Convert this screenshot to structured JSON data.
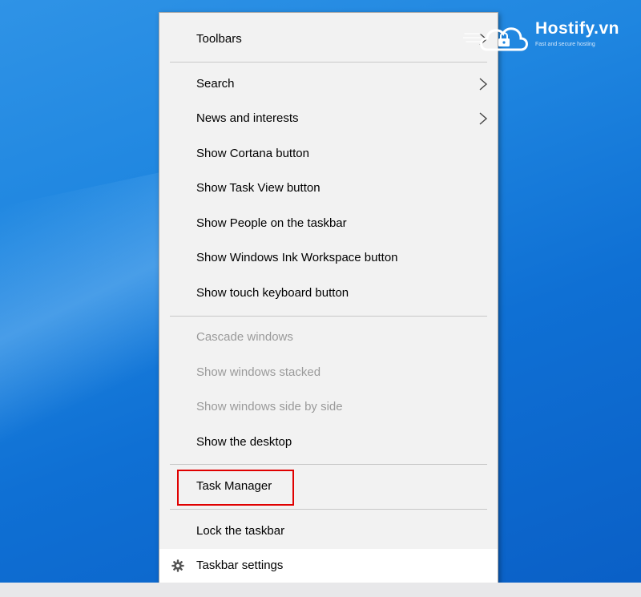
{
  "menu": {
    "items": [
      {
        "label": "Toolbars",
        "submenu": true,
        "enabled": true
      },
      {
        "label": "Search",
        "submenu": true,
        "enabled": true
      },
      {
        "label": "News and interests",
        "submenu": true,
        "enabled": true
      },
      {
        "label": "Show Cortana button",
        "submenu": false,
        "enabled": true
      },
      {
        "label": "Show Task View button",
        "submenu": false,
        "enabled": true
      },
      {
        "label": "Show People on the taskbar",
        "submenu": false,
        "enabled": true
      },
      {
        "label": "Show Windows Ink Workspace button",
        "submenu": false,
        "enabled": true
      },
      {
        "label": "Show touch keyboard button",
        "submenu": false,
        "enabled": true
      },
      {
        "label": "Cascade windows",
        "submenu": false,
        "enabled": false
      },
      {
        "label": "Show windows stacked",
        "submenu": false,
        "enabled": false
      },
      {
        "label": "Show windows side by side",
        "submenu": false,
        "enabled": false
      },
      {
        "label": "Show the desktop",
        "submenu": false,
        "enabled": true
      },
      {
        "label": "Task Manager",
        "submenu": false,
        "enabled": true,
        "highlighted_box": true
      },
      {
        "label": "Lock the taskbar",
        "submenu": false,
        "enabled": true
      },
      {
        "label": "Taskbar settings",
        "submenu": false,
        "enabled": true,
        "icon": "gear-icon",
        "hovered": true
      }
    ]
  },
  "watermark": {
    "brand": "Hostify.vn",
    "tagline": "Fast and secure hosting",
    "icon": "cloud-lock-icon"
  },
  "colors": {
    "desktop": "#1f86e0",
    "menu_bg": "#f2f2f2",
    "highlight_box": "#e00000",
    "disabled_text": "#9a9a9a"
  }
}
